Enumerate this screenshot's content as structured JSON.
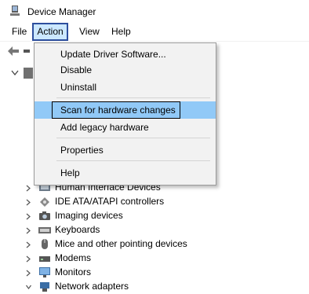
{
  "window": {
    "title": "Device Manager"
  },
  "menubar": {
    "file": "File",
    "action": "Action",
    "view": "View",
    "help": "Help"
  },
  "action_menu": {
    "update_driver": "Update Driver Software...",
    "disable": "Disable",
    "uninstall": "Uninstall",
    "scan": "Scan for hardware changes",
    "add_legacy": "Add legacy hardware",
    "properties": "Properties",
    "help": "Help"
  },
  "tree": {
    "items": [
      {
        "label": "Human Interface Devices",
        "icon": "hid-icon"
      },
      {
        "label": "IDE ATA/ATAPI controllers",
        "icon": "ide-controller-icon"
      },
      {
        "label": "Imaging devices",
        "icon": "camera-icon"
      },
      {
        "label": "Keyboards",
        "icon": "keyboard-icon"
      },
      {
        "label": "Mice and other pointing devices",
        "icon": "mouse-icon"
      },
      {
        "label": "Modems",
        "icon": "modem-icon"
      },
      {
        "label": "Monitors",
        "icon": "monitor-icon"
      },
      {
        "label": "Network adapters",
        "icon": "network-adapter-icon"
      }
    ]
  },
  "colors": {
    "highlight": "#91c9f7",
    "menu_active": "#cce8ff",
    "menu_border": "#2d4f9e"
  }
}
